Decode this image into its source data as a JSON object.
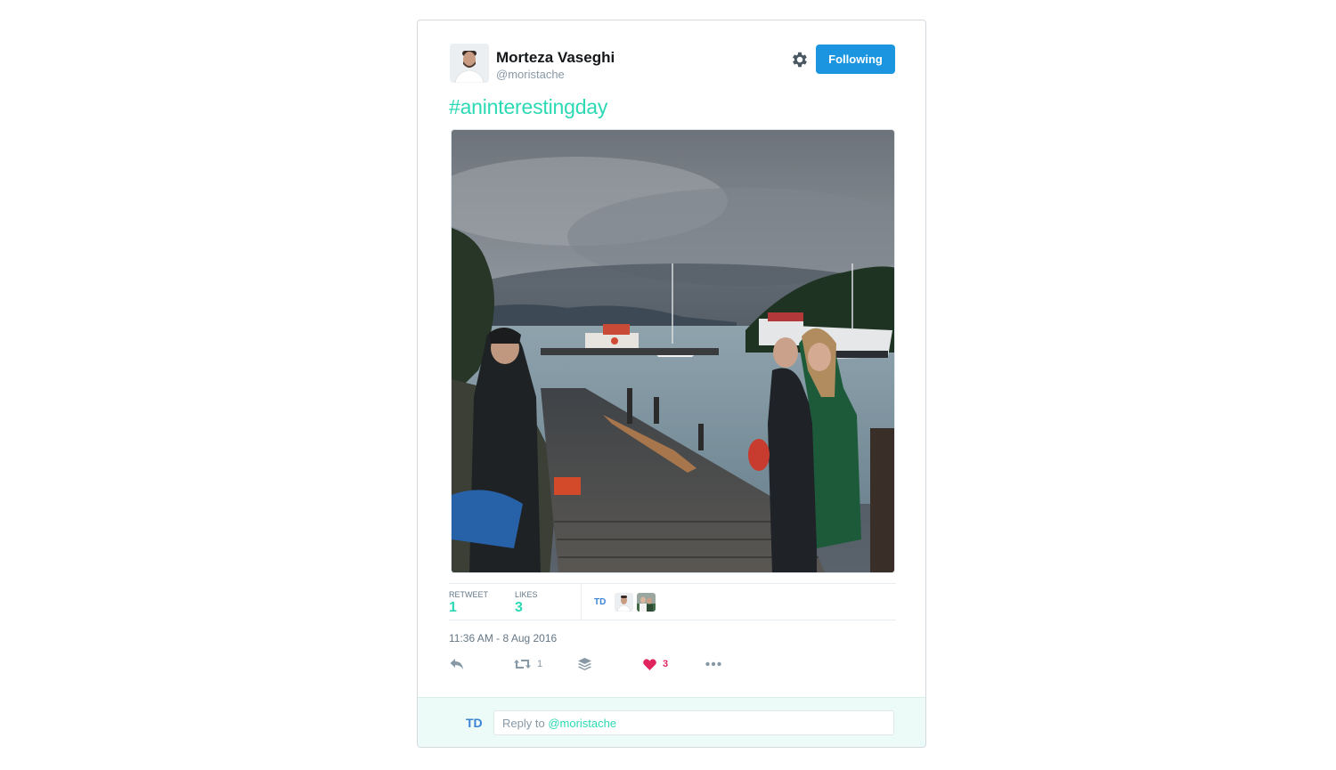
{
  "tweet": {
    "author": {
      "name": "Morteza Vaseghi",
      "handle": "@moristache"
    },
    "follow_button": "Following",
    "hashtag": "#aninterestingday",
    "stats": {
      "retweet_label": "RETWEET",
      "retweet_count": "1",
      "likes_label": "LIKES",
      "likes_count": "3"
    },
    "liker_brand": "TD",
    "timestamp": "11:36 AM - 8 Aug 2016",
    "actions": {
      "retweet_count": "1",
      "like_count": "3",
      "icons": [
        "reply-icon",
        "retweet-icon",
        "layers-icon",
        "heart-icon",
        "more-icon"
      ]
    }
  },
  "reply": {
    "brand": "TD",
    "prefix": "Reply to ",
    "handle": "@moristache"
  },
  "colors": {
    "accent": "#2bd9b4",
    "follow_button": "#1b95e0",
    "like": "#e0245e",
    "brand": "#3b83d4"
  }
}
